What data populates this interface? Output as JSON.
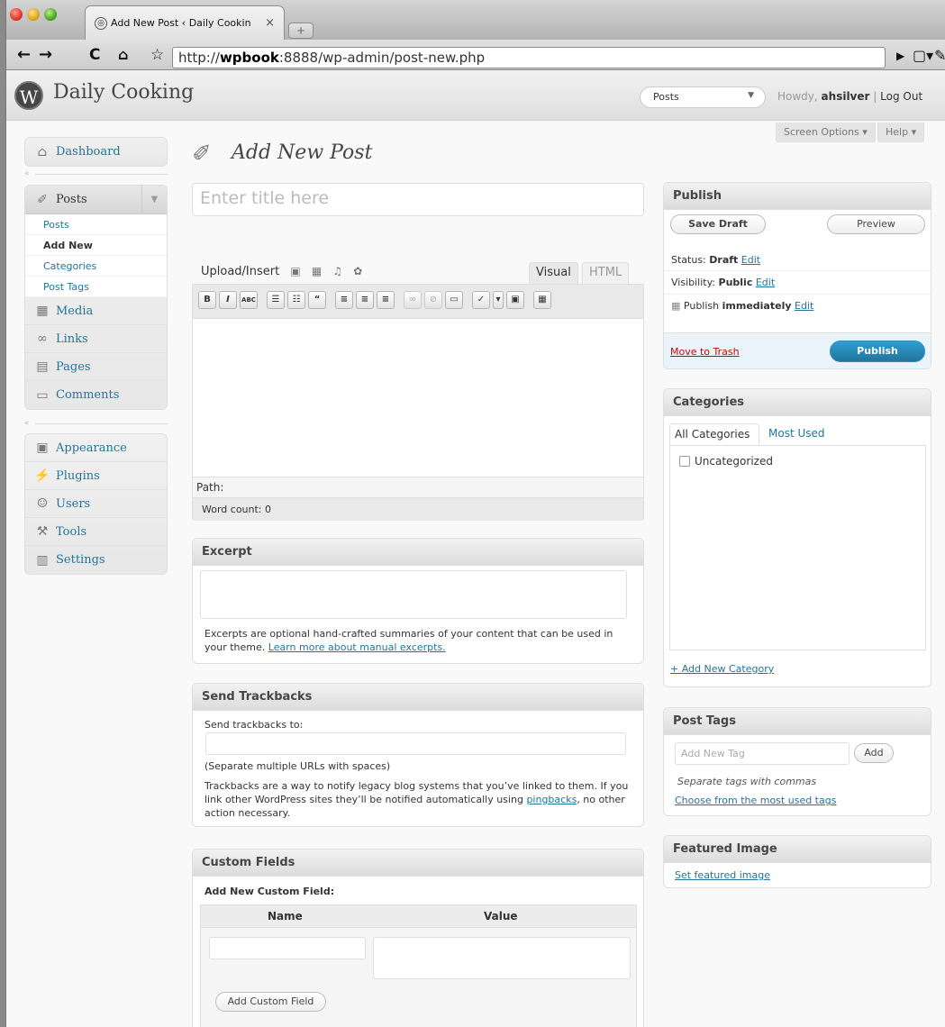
{
  "browser": {
    "tab_title": "Add New Post ‹ Daily Cookin",
    "tab_close": "×",
    "new_tab": "+",
    "url_prefix": "http://",
    "url_host": "wpbook",
    "url_rest": ":8888/wp-admin/post-new.php"
  },
  "header": {
    "logo": "W",
    "site_name": "Daily Cooking",
    "favorites_selected": "Posts",
    "howdy_prefix": "Howdy,",
    "username": "ahsilver",
    "separator": "|",
    "logout": "Log Out"
  },
  "screen_options": {
    "label": "Screen Options",
    "help": "Help"
  },
  "sidebar": {
    "dashboard": "Dashboard",
    "posts": "Posts",
    "posts_submenu": [
      "Posts",
      "Add New",
      "Categories",
      "Post Tags"
    ],
    "items": [
      "Media",
      "Links",
      "Pages",
      "Comments"
    ],
    "items2": [
      "Appearance",
      "Plugins",
      "Users",
      "Tools",
      "Settings"
    ]
  },
  "page": {
    "title": "Add New Post",
    "title_placeholder": "Enter title here"
  },
  "editor": {
    "upload_insert": "Upload/Insert",
    "tab_visual": "Visual",
    "tab_html": "HTML",
    "path_label": "Path:",
    "word_count": "Word count: 0",
    "toolbar": [
      "B",
      "I",
      "ABC",
      "☰",
      "☷",
      "“",
      "≡",
      "≡",
      "≡",
      "∞",
      "⊘",
      "▭",
      "✓",
      "▾",
      "▣",
      "▦"
    ]
  },
  "excerpt": {
    "title": "Excerpt",
    "help": "Excerpts are optional hand-crafted summaries of your content that can be used in your theme.",
    "link": "Learn more about manual excerpts."
  },
  "trackbacks": {
    "title": "Send Trackbacks",
    "label": "Send trackbacks to:",
    "hint": "(Separate multiple URLs with spaces)",
    "help": "Trackbacks are a way to notify legacy blog systems that you’ve linked to them. If you link other WordPress sites they’ll be notified automatically using",
    "link": "pingbacks",
    "help_end": ", no other action necessary."
  },
  "custom_fields": {
    "title": "Custom Fields",
    "subtitle": "Add New Custom Field:",
    "col_name": "Name",
    "col_value": "Value",
    "add_button": "Add Custom Field"
  },
  "publish": {
    "title": "Publish",
    "save_draft": "Save Draft",
    "preview": "Preview",
    "status_label": "Status:",
    "status_value": "Draft",
    "visibility_label": "Visibility:",
    "visibility_value": "Public",
    "publish_label": "Publish",
    "publish_value": "immediately",
    "edit": "Edit",
    "trash": "Move to Trash",
    "publish_button": "Publish"
  },
  "categories": {
    "title": "Categories",
    "tab_all": "All Categories",
    "tab_used": "Most Used",
    "items": [
      "Uncategorized"
    ],
    "add_new": "+ Add New Category"
  },
  "tags": {
    "title": "Post Tags",
    "placeholder": "Add New Tag",
    "add_button": "Add",
    "hint": "Separate tags with commas",
    "choose": "Choose from the most used tags"
  },
  "featured": {
    "title": "Featured Image",
    "link": "Set featured image"
  }
}
